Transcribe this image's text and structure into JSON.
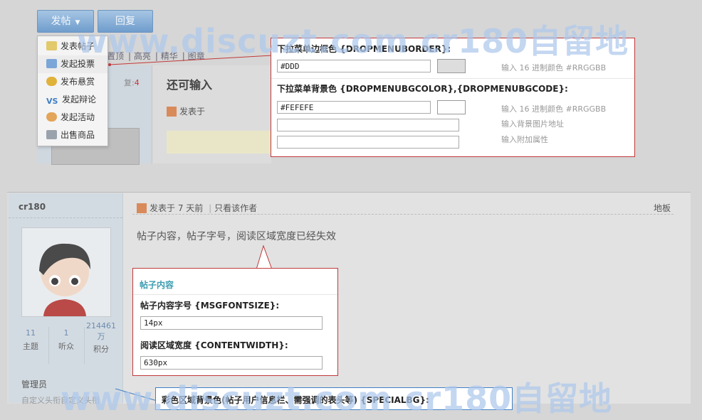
{
  "toolbar": {
    "post_label": "发帖",
    "reply_label": "回复"
  },
  "dropdown": {
    "items": [
      {
        "label": "发表帖子",
        "icon": "document-icon",
        "color": "#e2c96b"
      },
      {
        "label": "发起投票",
        "icon": "bar-chart-icon",
        "color": "#7ba6d8"
      },
      {
        "label": "发布悬赏",
        "icon": "coin-icon",
        "color": "#e0b23a"
      },
      {
        "label": "发起辩论",
        "icon": "vs-icon",
        "color": "#5a9bd5"
      },
      {
        "label": "发起活动",
        "icon": "people-icon",
        "color": "#e2a55a"
      },
      {
        "label": "出售商品",
        "icon": "cart-icon",
        "color": "#9aa3ad"
      }
    ]
  },
  "bg_forum": {
    "strip": [
      "置顶",
      "高亮",
      "精华",
      "图章"
    ],
    "reply_label": "复:",
    "reply_count": "4",
    "title_partial": "还可输入",
    "posted_partial": "发表于"
  },
  "panel_dropmenu": {
    "border_title": "下拉菜单边框色 {DROPMENUBORDER}:",
    "border_value": "#DDD",
    "border_hint": "输入 16 进制颜色 #RRGGBB",
    "bg_title": "下拉菜单背景色 {DROPMENUBGCOLOR},{DROPMENUBGCODE}:",
    "bg_value": "#FEFEFE",
    "bg_hint": "输入 16 进制颜色 #RRGGBB",
    "img_hint": "输入背景图片地址",
    "attr_hint": "输入附加属性",
    "border_swatch": "#dddddd",
    "bg_swatch": "#fefefe"
  },
  "post": {
    "author": "cr180",
    "posted": "发表于 7 天前",
    "only_author": "只看该作者",
    "floor": "地板",
    "content": "帖子内容，帖子字号，阅读区域宽度已经失效",
    "stats": [
      {
        "value": "11",
        "label": "主题"
      },
      {
        "value": "1",
        "label": "听众"
      },
      {
        "value": "214461万",
        "label": "积分"
      }
    ],
    "role": "管理员",
    "custom_title": "自定义头衔自定义头衔"
  },
  "panel_content": {
    "title": "帖子内容",
    "font_label": "帖子内容字号 {MSGFONTSIZE}:",
    "font_value": "14px",
    "width_label": "阅读区域宽度 {CONTENTWIDTH}:",
    "width_value": "630px"
  },
  "panel_special": {
    "title": "彩色区域背景色(帖子用户信息栏、需强调的表头等) {SPECIALBG}:"
  },
  "watermark": {
    "text": "www.discuzt.com cr180自留地"
  }
}
